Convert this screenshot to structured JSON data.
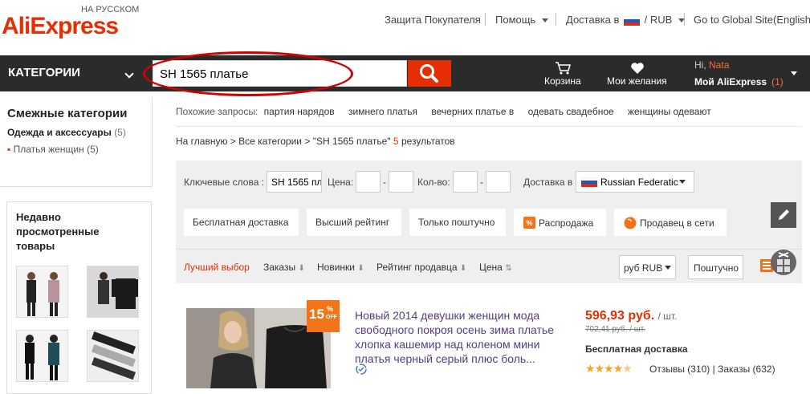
{
  "header": {
    "logo_ali": "Ali",
    "logo_express": "Express",
    "logo_subtitle": "НА РУССКОМ",
    "buyer_protection": "Защита Покупателя",
    "help": "Помощь",
    "delivery": "Доставка в",
    "currency": "/ RUB",
    "global_site": "Go to Global Site(English)"
  },
  "nav": {
    "categories": "КАТЕГОРИИ",
    "search_value": "SH 1565 платье",
    "cart": "Корзина",
    "wishlist": "Мои желания",
    "hi": "Hi,",
    "username": "Nata",
    "my_aliexpress": "Мой AliExpress",
    "my_count": "(1)"
  },
  "sidebar": {
    "related_title": "Смежные категории",
    "category": "Одежда и аксессуары",
    "category_count": "(5)",
    "subcategory": "Платья женщин",
    "subcategory_count": "(5)",
    "recent_title": "Недавно просмотренные товары"
  },
  "similar": {
    "label": "Похожие запросы:",
    "items": [
      "партия нарядов",
      "зимнего платья",
      "вечерних платье в",
      "одевать свадебное",
      "женщины одевают"
    ]
  },
  "breadcrumb": {
    "home": "На главную",
    "all_categories": "Все категории",
    "query": "\"SH 1565 платье\"",
    "count": "5",
    "results": "результатов"
  },
  "filters": {
    "keywords_label": "Ключевые слова :",
    "keywords_value": "SH 1565 пл",
    "price_label": "Цена:",
    "qty_label": "Кол-во:",
    "dash": "-",
    "ship_to_label": "Доставка в",
    "country": "Russian Federatic",
    "buttons": [
      "Бесплатная доставка",
      "Высший рейтинг",
      "Только поштучно",
      "Распродажа",
      "Продавец в сети"
    ]
  },
  "sort": {
    "best": "Лучший выбор",
    "orders": "Заказы",
    "new": "Новинки",
    "seller_rating": "Рейтинг продавца",
    "price": "Цена",
    "currency": "руб RUB",
    "per_unit": "Поштучно"
  },
  "product": {
    "discount_value": "15",
    "discount_pct": "%",
    "discount_off": "OFF",
    "title": "Новый 2014 девушки женщин мода свободного покроя осень зима платье хлопка кашемир над коленом мини платья черный серый плюс боль...",
    "price": "596,93 руб.",
    "price_unit": "/ шт.",
    "old_price": "702,41 руб. / шт.",
    "free_shipping": "Бесплатная доставка",
    "rating": 4.5,
    "reviews": "Отзывы (310)",
    "orders": "Заказы (632)"
  },
  "colors": {
    "brand_red": "#e62e04",
    "nav_dark": "#2b2b2b",
    "discount_orange": "#f37318",
    "title_purple": "#563d80"
  }
}
